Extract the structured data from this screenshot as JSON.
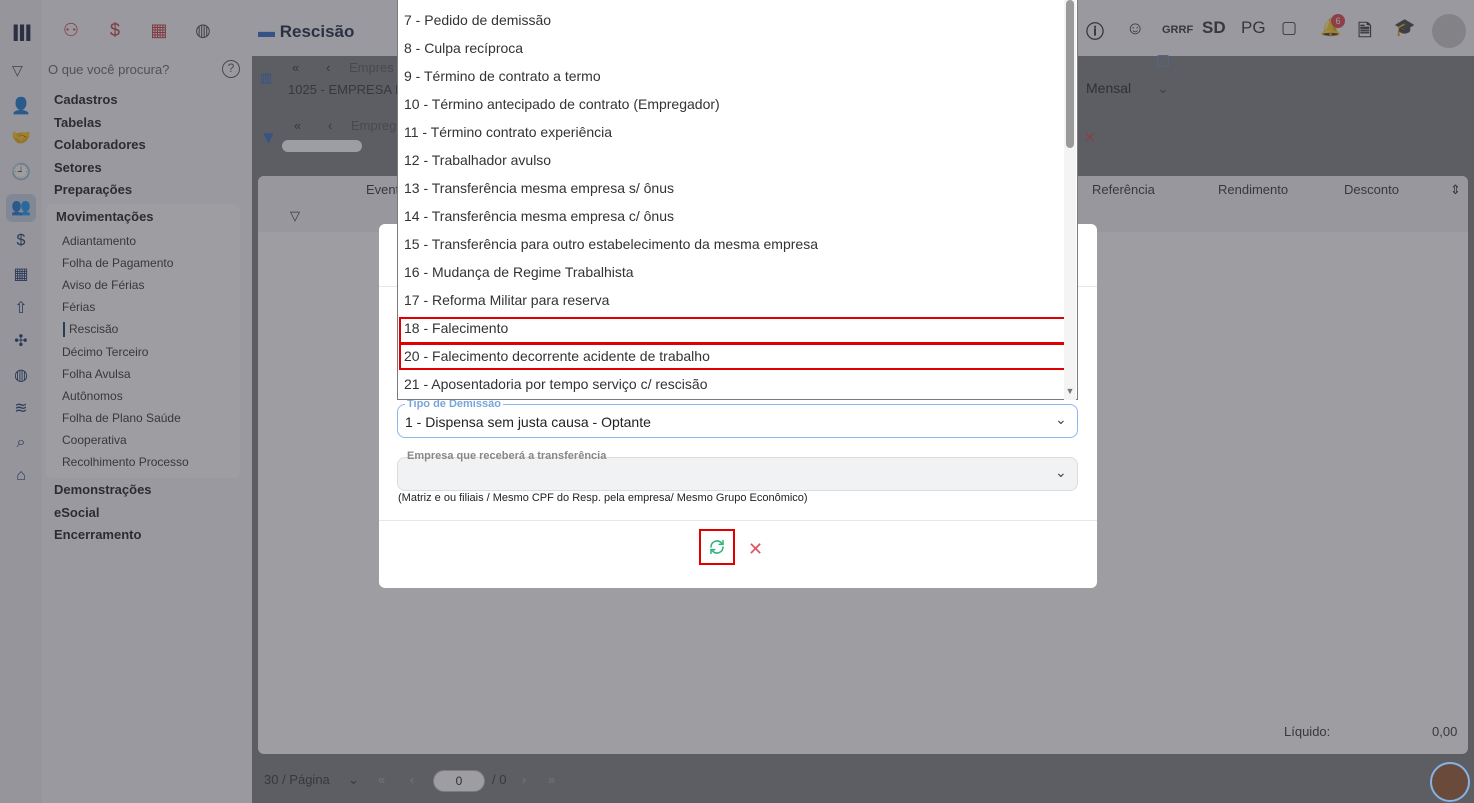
{
  "top_nav": {
    "title": "Rescisão",
    "right_items": [
      "GRRF",
      "SD",
      "PG"
    ],
    "notification_count": "6"
  },
  "menu": {
    "search_placeholder": "O que você procura?",
    "sections": [
      "Cadastros",
      "Tabelas",
      "Colaboradores",
      "Setores",
      "Preparações",
      "Movimentações",
      "Demonstrações",
      "eSocial",
      "Encerramento"
    ],
    "movimentacoes_items": [
      "Adiantamento",
      "Folha de Pagamento",
      "Aviso de Férias",
      "Férias",
      "Rescisão",
      "Décimo Terceiro",
      "Folha Avulsa",
      "Autônomos",
      "Folha de Plano Saúde",
      "Cooperativa",
      "Recolhimento Processo"
    ]
  },
  "breadcrumb": {
    "empresa_label": "Empres",
    "empresa_value": "1025 - EMPRESA M",
    "empregado_label": "Empreg"
  },
  "grid": {
    "columns": [
      "Event",
      "Referência",
      "Rendimento",
      "Desconto"
    ],
    "liquido_label": "Líquido:",
    "liquido_value": "0,00",
    "periodicidade": "Mensal"
  },
  "pager": {
    "per_page": "30 / Página",
    "current": "0",
    "total": "/ 0"
  },
  "dropdown_options": [
    "7 - Pedido de demissão",
    "8 - Culpa recíproca",
    "9 - Término de contrato a termo",
    "10 - Término antecipado de contrato (Empregador)",
    "11 - Término contrato experiência",
    "12 - Trabalhador avulso",
    "13 - Transferência mesma empresa s/ ônus",
    "14 - Transferência mesma empresa c/ ônus",
    "15 - Transferência para outro estabelecimento da mesma empresa",
    "16 - Mudança de Regime Trabalhista",
    "17 - Reforma Militar para reserva",
    "18 - Falecimento",
    "20 - Falecimento decorrente acidente de trabalho",
    "21 - Aposentadoria por tempo serviço c/ rescisão"
  ],
  "modal": {
    "tipo_label": "Tipo de Demissão",
    "tipo_value": "1 - Dispensa sem justa causa - Optante",
    "empresa_label": "Empresa que receberá a transferência",
    "hint": "(Matriz e ou filiais / Mesmo CPF do Resp. pela empresa/ Mesmo Grupo Econômico)"
  },
  "colors": {
    "highlight": "#e00000",
    "refresh": "#2bb57a",
    "close": "#e0545b",
    "accent_blue": "#7aa6dc"
  }
}
